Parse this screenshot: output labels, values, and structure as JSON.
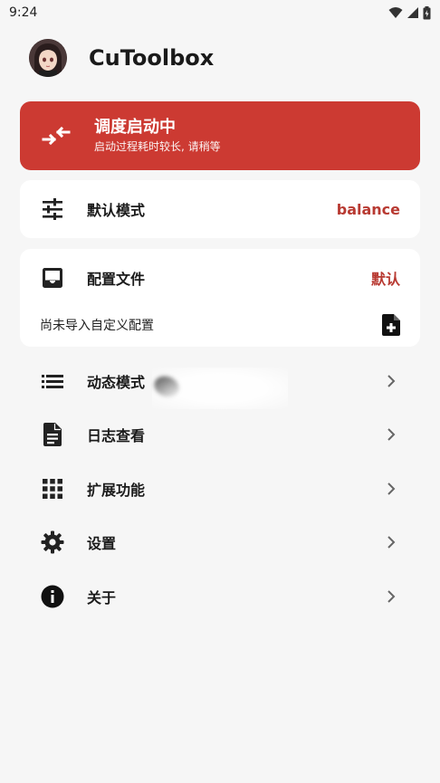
{
  "status_bar": {
    "time": "9:24"
  },
  "header": {
    "app_name": "CuToolbox"
  },
  "scheduler_card": {
    "title": "调度启动中",
    "subtitle": "启动过程耗时较长, 请稍等",
    "background_color": "#cc3a32"
  },
  "mode_card": {
    "label": "默认模式",
    "value": "balance"
  },
  "config_card": {
    "label": "配置文件",
    "value": "默认",
    "note": "尚未导入自定义配置"
  },
  "menu": [
    {
      "label": "动态模式",
      "icon": "list-icon"
    },
    {
      "label": "日志查看",
      "icon": "document-icon"
    },
    {
      "label": "扩展功能",
      "icon": "grid-icon"
    },
    {
      "label": "设置",
      "icon": "gear-icon"
    },
    {
      "label": "关于",
      "icon": "info-icon"
    }
  ],
  "colors": {
    "accent": "#cc3a32",
    "value_text": "#b83a32",
    "background": "#f6f6f6"
  }
}
